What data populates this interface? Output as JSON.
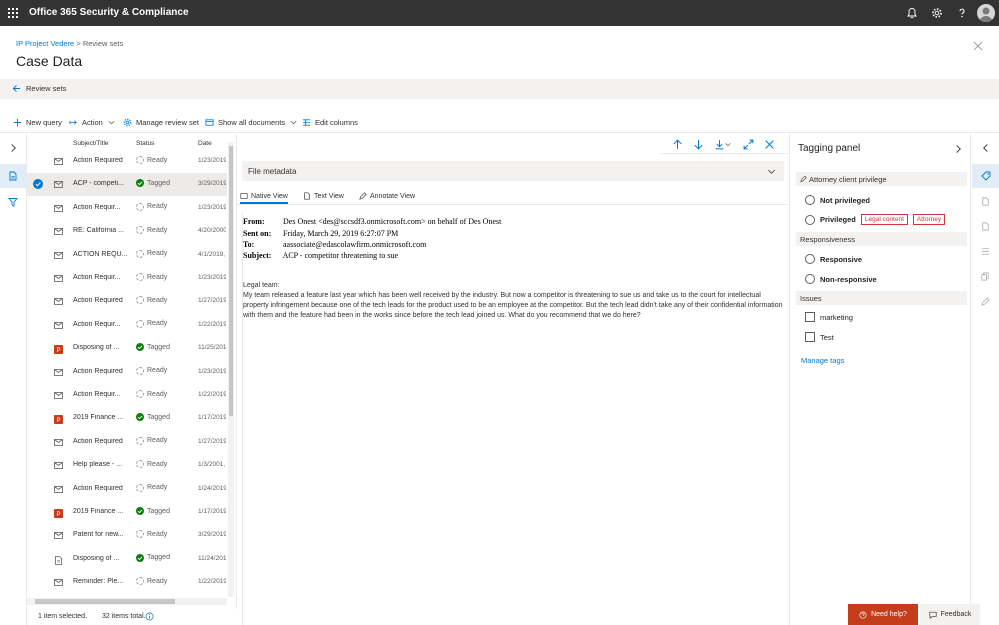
{
  "app": {
    "title": "Office 365 Security & Compliance"
  },
  "breadcrumb": {
    "parent": "IP Project Vedere",
    "separator": ">",
    "current": "Review sets"
  },
  "page": {
    "title": "Case Data",
    "back_label": "Review sets"
  },
  "toolbar": {
    "new_query": "New query",
    "action": "Action",
    "manage_review_set": "Manage review set",
    "show_all_documents": "Show all documents",
    "edit_columns": "Edit columns"
  },
  "list": {
    "columns": {
      "subject": "Subject/Title",
      "status": "Status",
      "date": "Date"
    },
    "rows": [
      {
        "subject": "Action Required",
        "status": "Ready",
        "date": "1/23/2019",
        "icon": "mail-icon",
        "selected": false
      },
      {
        "subject": "ACP - competi...",
        "status": "Tagged",
        "date": "3/29/2019",
        "icon": "mail-icon",
        "selected": true
      },
      {
        "subject": "Action Requir...",
        "status": "Ready",
        "date": "1/23/2019",
        "icon": "mail-icon",
        "selected": false
      },
      {
        "subject": "RE: California ...",
        "status": "Ready",
        "date": "4/20/2000",
        "icon": "mail-icon",
        "selected": false
      },
      {
        "subject": "ACTION REQU...",
        "status": "Ready",
        "date": "4/1/2019,",
        "icon": "mail-icon",
        "selected": false
      },
      {
        "subject": "Action Requir...",
        "status": "Ready",
        "date": "1/23/2019",
        "icon": "mail-icon",
        "selected": false
      },
      {
        "subject": "Action Required",
        "status": "Ready",
        "date": "1/27/2019",
        "icon": "mail-icon",
        "selected": false
      },
      {
        "subject": "Action Requir...",
        "status": "Ready",
        "date": "1/22/2019",
        "icon": "mail-icon",
        "selected": false
      },
      {
        "subject": "Disposing of ...",
        "status": "Tagged",
        "date": "11/25/201",
        "icon": "powerpoint-icon",
        "selected": false
      },
      {
        "subject": "Action Required",
        "status": "Ready",
        "date": "1/23/2019",
        "icon": "mail-icon",
        "selected": false
      },
      {
        "subject": "Action Requir...",
        "status": "Ready",
        "date": "1/22/2019",
        "icon": "mail-icon",
        "selected": false
      },
      {
        "subject": "2019 Finance ...",
        "status": "Tagged",
        "date": "1/17/2019",
        "icon": "powerpoint-icon",
        "selected": false
      },
      {
        "subject": "Action Required",
        "status": "Ready",
        "date": "1/27/2019",
        "icon": "mail-icon",
        "selected": false
      },
      {
        "subject": "Help please - ...",
        "status": "Ready",
        "date": "1/3/2001,",
        "icon": "mail-icon",
        "selected": false
      },
      {
        "subject": "Action Required",
        "status": "Ready",
        "date": "1/24/2019",
        "icon": "mail-icon",
        "selected": false
      },
      {
        "subject": "2019 Finance ...",
        "status": "Tagged",
        "date": "1/17/2019",
        "icon": "powerpoint-icon",
        "selected": false
      },
      {
        "subject": "Patent for new...",
        "status": "Ready",
        "date": "3/29/2019",
        "icon": "mail-icon",
        "selected": false
      },
      {
        "subject": "Disposing of ...",
        "status": "Tagged",
        "date": "11/24/201",
        "icon": "document-icon",
        "selected": false
      },
      {
        "subject": "Reminder: Ple...",
        "status": "Ready",
        "date": "1/22/2019",
        "icon": "mail-icon",
        "selected": false
      }
    ],
    "footer": {
      "selected": "1 item selected.",
      "total": "32 items total."
    }
  },
  "document": {
    "file_metadata_label": "File metadata",
    "tabs": {
      "native": "Native View",
      "text": "Text View",
      "annotate": "Annotate View"
    },
    "headers": {
      "from_label": "From:",
      "from_value": "Des Onest <des@sccsdf3.onmicrosoft.com> on behalf of Des Onest",
      "sent_label": "Sent on:",
      "sent_value": "Friday, March 29, 2019 6:27:07 PM",
      "to_label": "To:",
      "to_value": "aassociate@edascolawfirm.onmicrosoft.com",
      "subject_label": "Subject:",
      "subject_value": "ACP - competitor threatening to sue"
    },
    "greeting": "Legal team:",
    "body": "My team released a feature last year which has been well received by the industry. But now a competitor is threatening to sue us and take us to the court for intellectual property infringement because one of the tech leads for the product used to be an employee at the competitor. But the tech lead didn't take any of their confidential information with them and the feature had been in the works since before the tech lead joined us. What do you recommend that we do here?"
  },
  "tagging": {
    "title": "Tagging panel",
    "sections": {
      "acp": "Attorney client privilege",
      "responsiveness": "Responsiveness",
      "issues": "Issues"
    },
    "options": {
      "not_privileged": "Not privileged",
      "privileged": "Privileged",
      "legal_content": "Legal content",
      "attorney": "Attorney",
      "responsive": "Responsive",
      "non_responsive": "Non-responsive",
      "marketing": "marketing",
      "test": "Test"
    },
    "manage_tags": "Manage tags"
  },
  "help": {
    "need_help": "Need help?",
    "feedback": "Feedback"
  },
  "colors": {
    "accent": "#0078d4",
    "tagged": "#107c10",
    "chip": "#d13438",
    "help": "#c43e1c",
    "topbar": "#333333"
  }
}
